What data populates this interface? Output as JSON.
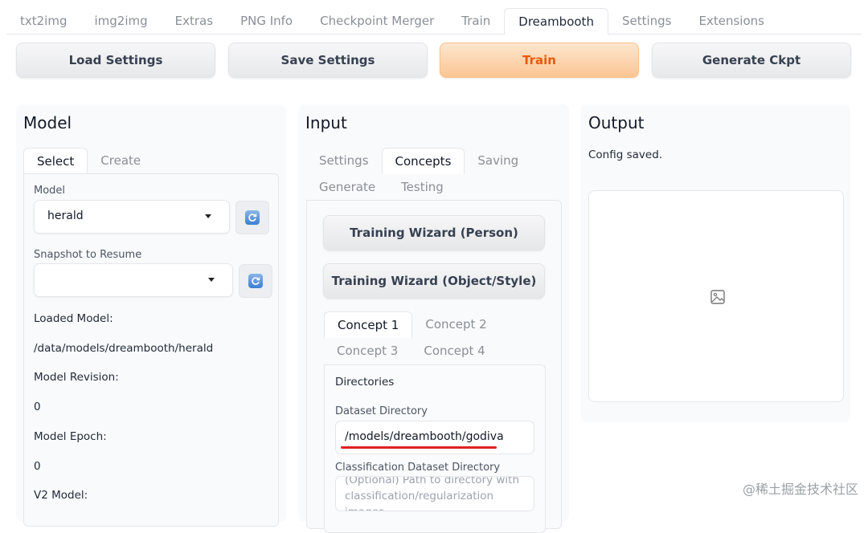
{
  "top_tabs": [
    "txt2img",
    "img2img",
    "Extras",
    "PNG Info",
    "Checkpoint Merger",
    "Train",
    "Dreambooth",
    "Settings",
    "Extensions"
  ],
  "active_top_tab": "Dreambooth",
  "actions": {
    "load_settings": "Load Settings",
    "save_settings": "Save Settings",
    "train": "Train",
    "generate_ckpt": "Generate Ckpt"
  },
  "model_panel": {
    "title": "Model",
    "tabs": [
      "Select",
      "Create"
    ],
    "model_label": "Model",
    "model_value": "herald",
    "snapshot_label": "Snapshot to Resume",
    "snapshot_value": "",
    "loaded_model_label": "Loaded Model:",
    "loaded_model_value": "/data/models/dreambooth/herald",
    "revision_label": "Model Revision:",
    "revision_value": "0",
    "epoch_label": "Model Epoch:",
    "epoch_value": "0",
    "v2_label": "V2 Model:"
  },
  "input_panel": {
    "title": "Input",
    "tabs_row1": [
      "Settings",
      "Concepts",
      "Saving"
    ],
    "tabs_row2": [
      "Generate",
      "Testing"
    ],
    "wizard_person": "Training Wizard (Person)",
    "wizard_object": "Training Wizard (Object/Style)",
    "concept_tabs_row1": [
      "Concept 1",
      "Concept 2"
    ],
    "concept_tabs_row2": [
      "Concept 3",
      "Concept 4"
    ],
    "directories_title": "Directories",
    "dataset_dir_label": "Dataset Directory",
    "dataset_dir_value": "/models/dreambooth/godiva",
    "class_dir_label": "Classification Dataset Directory",
    "class_dir_placeholder": "(Optional) Path to directory with classification/regularization images"
  },
  "output_panel": {
    "title": "Output",
    "status": "Config saved."
  },
  "watermark": "@稀土掘金技术社区",
  "colors": {
    "accent": "#ea580c",
    "underline": "#e02020"
  },
  "icons": {
    "refresh": "refresh-icon",
    "image": "image-icon",
    "dropdown": "chevron-down-icon"
  }
}
